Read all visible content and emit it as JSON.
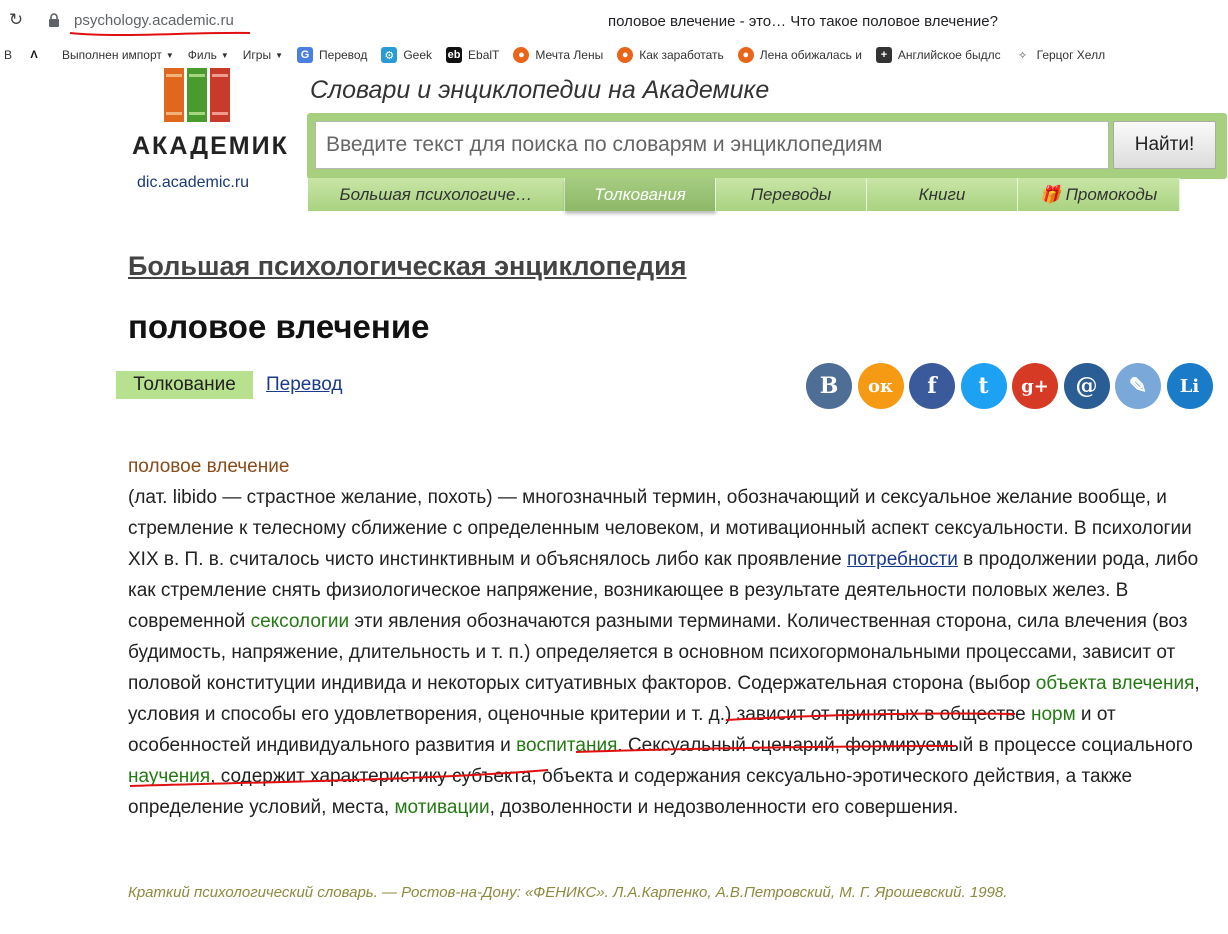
{
  "browser": {
    "url": "psychology.academic.ru",
    "tab_title": "половое влечение - это… Что такое половое влечение?",
    "bookmarks": [
      {
        "label": "В",
        "icon": "partial-icon"
      },
      {
        "label": "",
        "icon": "lambda-icon"
      },
      {
        "label": "Выполнен импорт",
        "icon": "",
        "dropdown": true
      },
      {
        "label": "Филь",
        "icon": "",
        "dropdown": true
      },
      {
        "label": "Игры",
        "icon": "",
        "dropdown": true
      },
      {
        "label": "Перевод",
        "icon": "translate-icon"
      },
      {
        "label": "Geek",
        "icon": "gear-icon"
      },
      {
        "label": "EbalT",
        "icon": "eb-icon"
      },
      {
        "label": "Мечта Лены",
        "icon": "orange-circle-icon"
      },
      {
        "label": "Как заработать",
        "icon": "orange-circle-icon"
      },
      {
        "label": "Лена обижалась и",
        "icon": "orange-circle-icon"
      },
      {
        "label": "Английское быдлс",
        "icon": "plus-square-icon"
      },
      {
        "label": "Герцог Хелл",
        "icon": "puzzle-icon"
      }
    ]
  },
  "site": {
    "logo_word": "АКАДЕМИК",
    "logo_domain": "dic.academic.ru",
    "slogan": "Словари и энциклопедии на Академике",
    "search_placeholder": "Введите текст для поиска по словарям и энциклопедиям",
    "search_button": "Найти!",
    "tabs": [
      {
        "label": "Большая психологиче…",
        "active": false
      },
      {
        "label": "Толкования",
        "active": true
      },
      {
        "label": "Переводы",
        "active": false
      },
      {
        "label": "Книги",
        "active": false
      },
      {
        "label": "🎁 Промокоды",
        "active": false
      }
    ]
  },
  "article": {
    "dictionary_title": "Большая психологическая энциклопедия",
    "headword": "половое влечение",
    "mode_active": "Толкование",
    "mode_link": "Перевод",
    "social": [
      {
        "name": "vk",
        "glyph": "В",
        "color": "#4e6e96"
      },
      {
        "name": "odnoklassniki",
        "glyph": "ок",
        "color": "#f59a12"
      },
      {
        "name": "facebook",
        "glyph": "f",
        "color": "#3b5a9b"
      },
      {
        "name": "twitter",
        "glyph": "t",
        "color": "#1da1f2"
      },
      {
        "name": "google-plus",
        "glyph": "g+",
        "color": "#d63a25"
      },
      {
        "name": "mail",
        "glyph": "@",
        "color": "#2a5d93"
      },
      {
        "name": "livejournal",
        "glyph": "✎",
        "color": "#7aa9d9"
      },
      {
        "name": "linkedin",
        "glyph": "Li",
        "color": "#1a7bc9"
      }
    ],
    "entry_head": "половое влечение",
    "t01": "(лат. libido — страстное желание, похоть) — многозначный термин, обозначающий и сексуальное желание вообще, и стремление к телесному сближение с определенным человеком, и мотивационный аспект сексуальности. В психологии XIX в. П. в. считалось чисто инстинктивным и объяснялось либо как проявление ",
    "l01": "потребности",
    "t02": " в продолжении рода, либо как стремление снять физиологическое напряжение, возникающее в результате деятельности половых желез. В современной ",
    "l02": "сексологии",
    "t03": " эти явления обозначаются разными терминами. Количественная сторона, сила влечения (воз будимость, напряжение, длительность и т. п.) определяется в основном психогормональными процессами, зависит от половой конституции индивида и некоторых ситуативных факторов. Содержательная сторона (выбор ",
    "l03": "объекта влечения",
    "t04": ", условия и способы его удовлетворения, оценочные критерии и т. д.) зависит от принятых в обществе ",
    "l04": "норм",
    "t05": " и от особенностей индивидуального развития и ",
    "l05": "воспитания",
    "t06": ". Сексуальный сценарий, формируемый в процессе социального ",
    "l06": "научения",
    "t07": ", содержит характеристику субъекта, объекта и содержания сексуально-эротического действия, а также определение условий, места, ",
    "l07": "мотивации",
    "t08": ", дозволенности и недозволенности его совершения.",
    "source": "Краткий психологический словарь. — Ростов-на-Дону: «ФЕНИКС». Л.А.Карпенко, А.В.Петровский, М. Г. Ярошевский. 1998."
  },
  "colors": {
    "accent_green": "#a6cf7e",
    "link_blue": "#1a3a8a",
    "link_green": "#237a12",
    "annotation_red": "#e01010"
  }
}
